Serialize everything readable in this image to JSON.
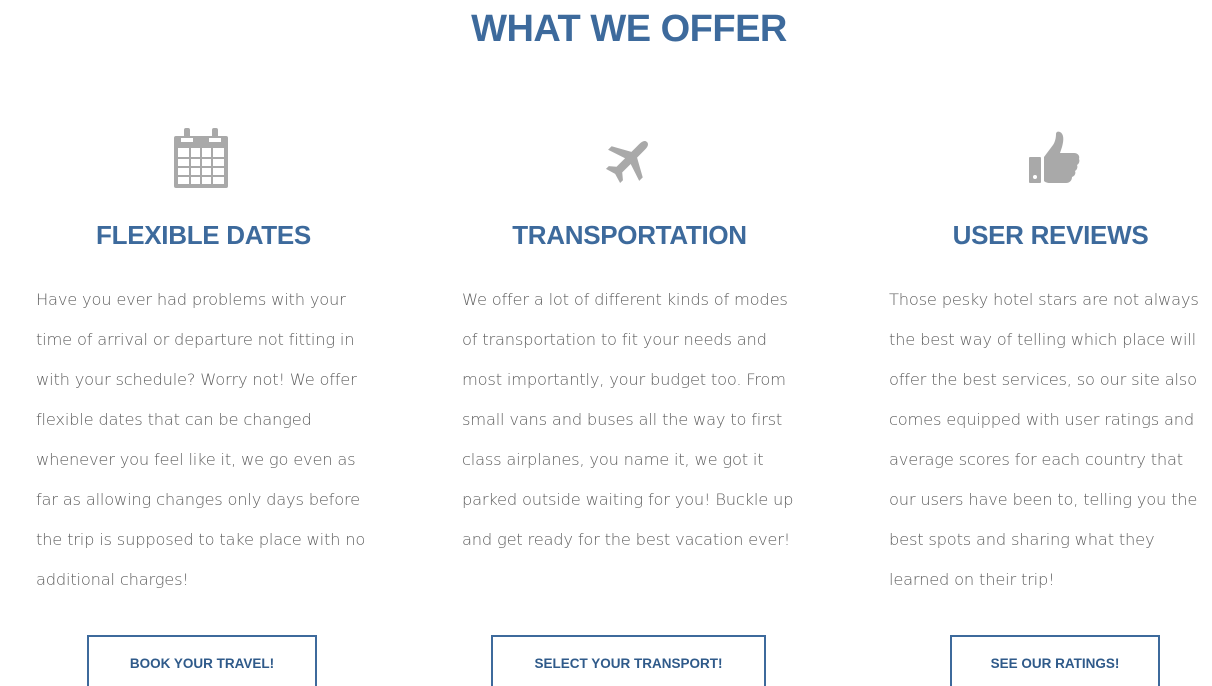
{
  "section": {
    "title": "WHAT WE OFFER"
  },
  "features": [
    {
      "icon": "calendar-icon",
      "title": "FLEXIBLE DATES",
      "text": "Have you ever had problems with your time of arrival or departure not fitting in with your schedule? Worry not! We offer flexible dates that can be changed whenever you feel like it, we go even as far as allowing changes only days before the trip is supposed to take place with no additional charges!",
      "button_label": "BOOK YOUR TRAVEL!"
    },
    {
      "icon": "plane-icon",
      "title": "TRANSPORTATION",
      "text": "We offer a lot of different kinds of modes of transportation to fit your needs and most importantly, your budget too. From small vans and buses all the way to first class airplanes, you name it, we got it parked outside waiting for you! Buckle up and get ready for the best vacation ever!",
      "button_label": "SELECT YOUR TRANSPORT!"
    },
    {
      "icon": "thumbs-up-icon",
      "title": "USER REVIEWS",
      "text": "Those pesky hotel stars are not always the best way of telling which place will offer the best services, so our site also comes equipped with user ratings and average scores for each country that our users have been to, telling you the best spots and sharing what they learned on their trip!",
      "button_label": "SEE OUR RATINGS!"
    }
  ],
  "colors": {
    "accent": "#3d6a9c",
    "body_text": "#5f5f5f",
    "icon": "#a9a9a9"
  }
}
